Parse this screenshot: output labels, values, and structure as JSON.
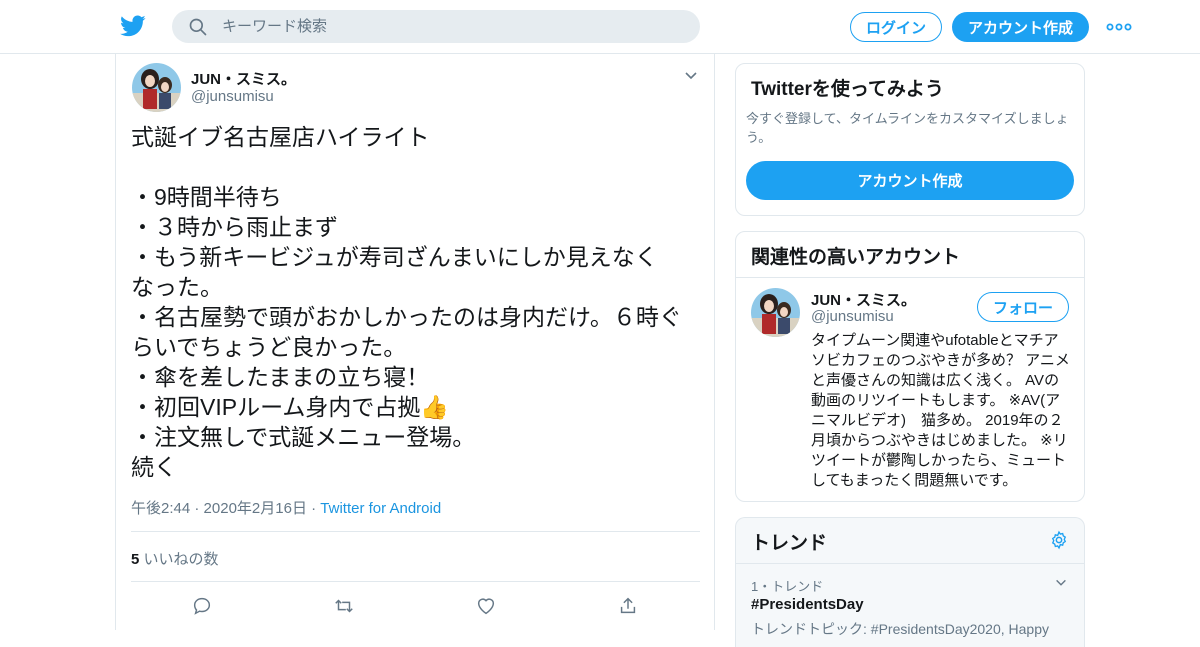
{
  "header": {
    "search_placeholder": "キーワード検索",
    "login_label": "ログイン",
    "signup_label": "アカウント作成",
    "logo_icon": "twitter-bird-icon",
    "more_icon": "more-dots-icon",
    "brand_color": "#1da1f2"
  },
  "tweet": {
    "name": "JUN・スミス。",
    "handle": "@junsumisu",
    "text": "式誕イブ名古屋店ハイライト\n\n・9時間半待ち\n・３時から雨止まず\n・もう新キービジュが寿司ざんまいにしか見えなく\nなった。\n・名古屋勢で頭がおかしかったのは身内だけ。６時ぐ\nらいでちょうど良かった。\n・傘を差したままの立ち寝！\n・初回VIPルーム身内で占拠👍\n・注文無しで式誕メニュー登場。\n続く",
    "time": "午後2:44",
    "date": "2020年2月16日",
    "dot": " · ",
    "source": "Twitter for Android",
    "likes_count": "5",
    "likes_label": "いいねの数"
  },
  "signup_card": {
    "title": "Twitterを使ってみよう",
    "desc": "今すぐ登録して、タイムラインをカスタマイズしましょう。",
    "button": "アカウント作成"
  },
  "related": {
    "title": "関連性の高いアカウント",
    "name": "JUN・スミス。",
    "handle": "@junsumisu",
    "follow": "フォロー",
    "bio": "タイプムーン関連やufotableとマチアソビカフェのつぶやきが多め？ アニメと声優さんの知識は広く浅く。 AVの動画のリツイートもします。 ※AV(アニマルビデオ)　猫多め。 2019年の２月頃からつぶやきはじめました。 ※リツイートが鬱陶しかったら、ミュートしてもまったく問題無いです。"
  },
  "trends": {
    "title": "トレンド",
    "rank": "1・トレンド",
    "tag": "#PresidentsDay",
    "topic": "トレンドトピック: #PresidentsDay2020, Happy"
  }
}
